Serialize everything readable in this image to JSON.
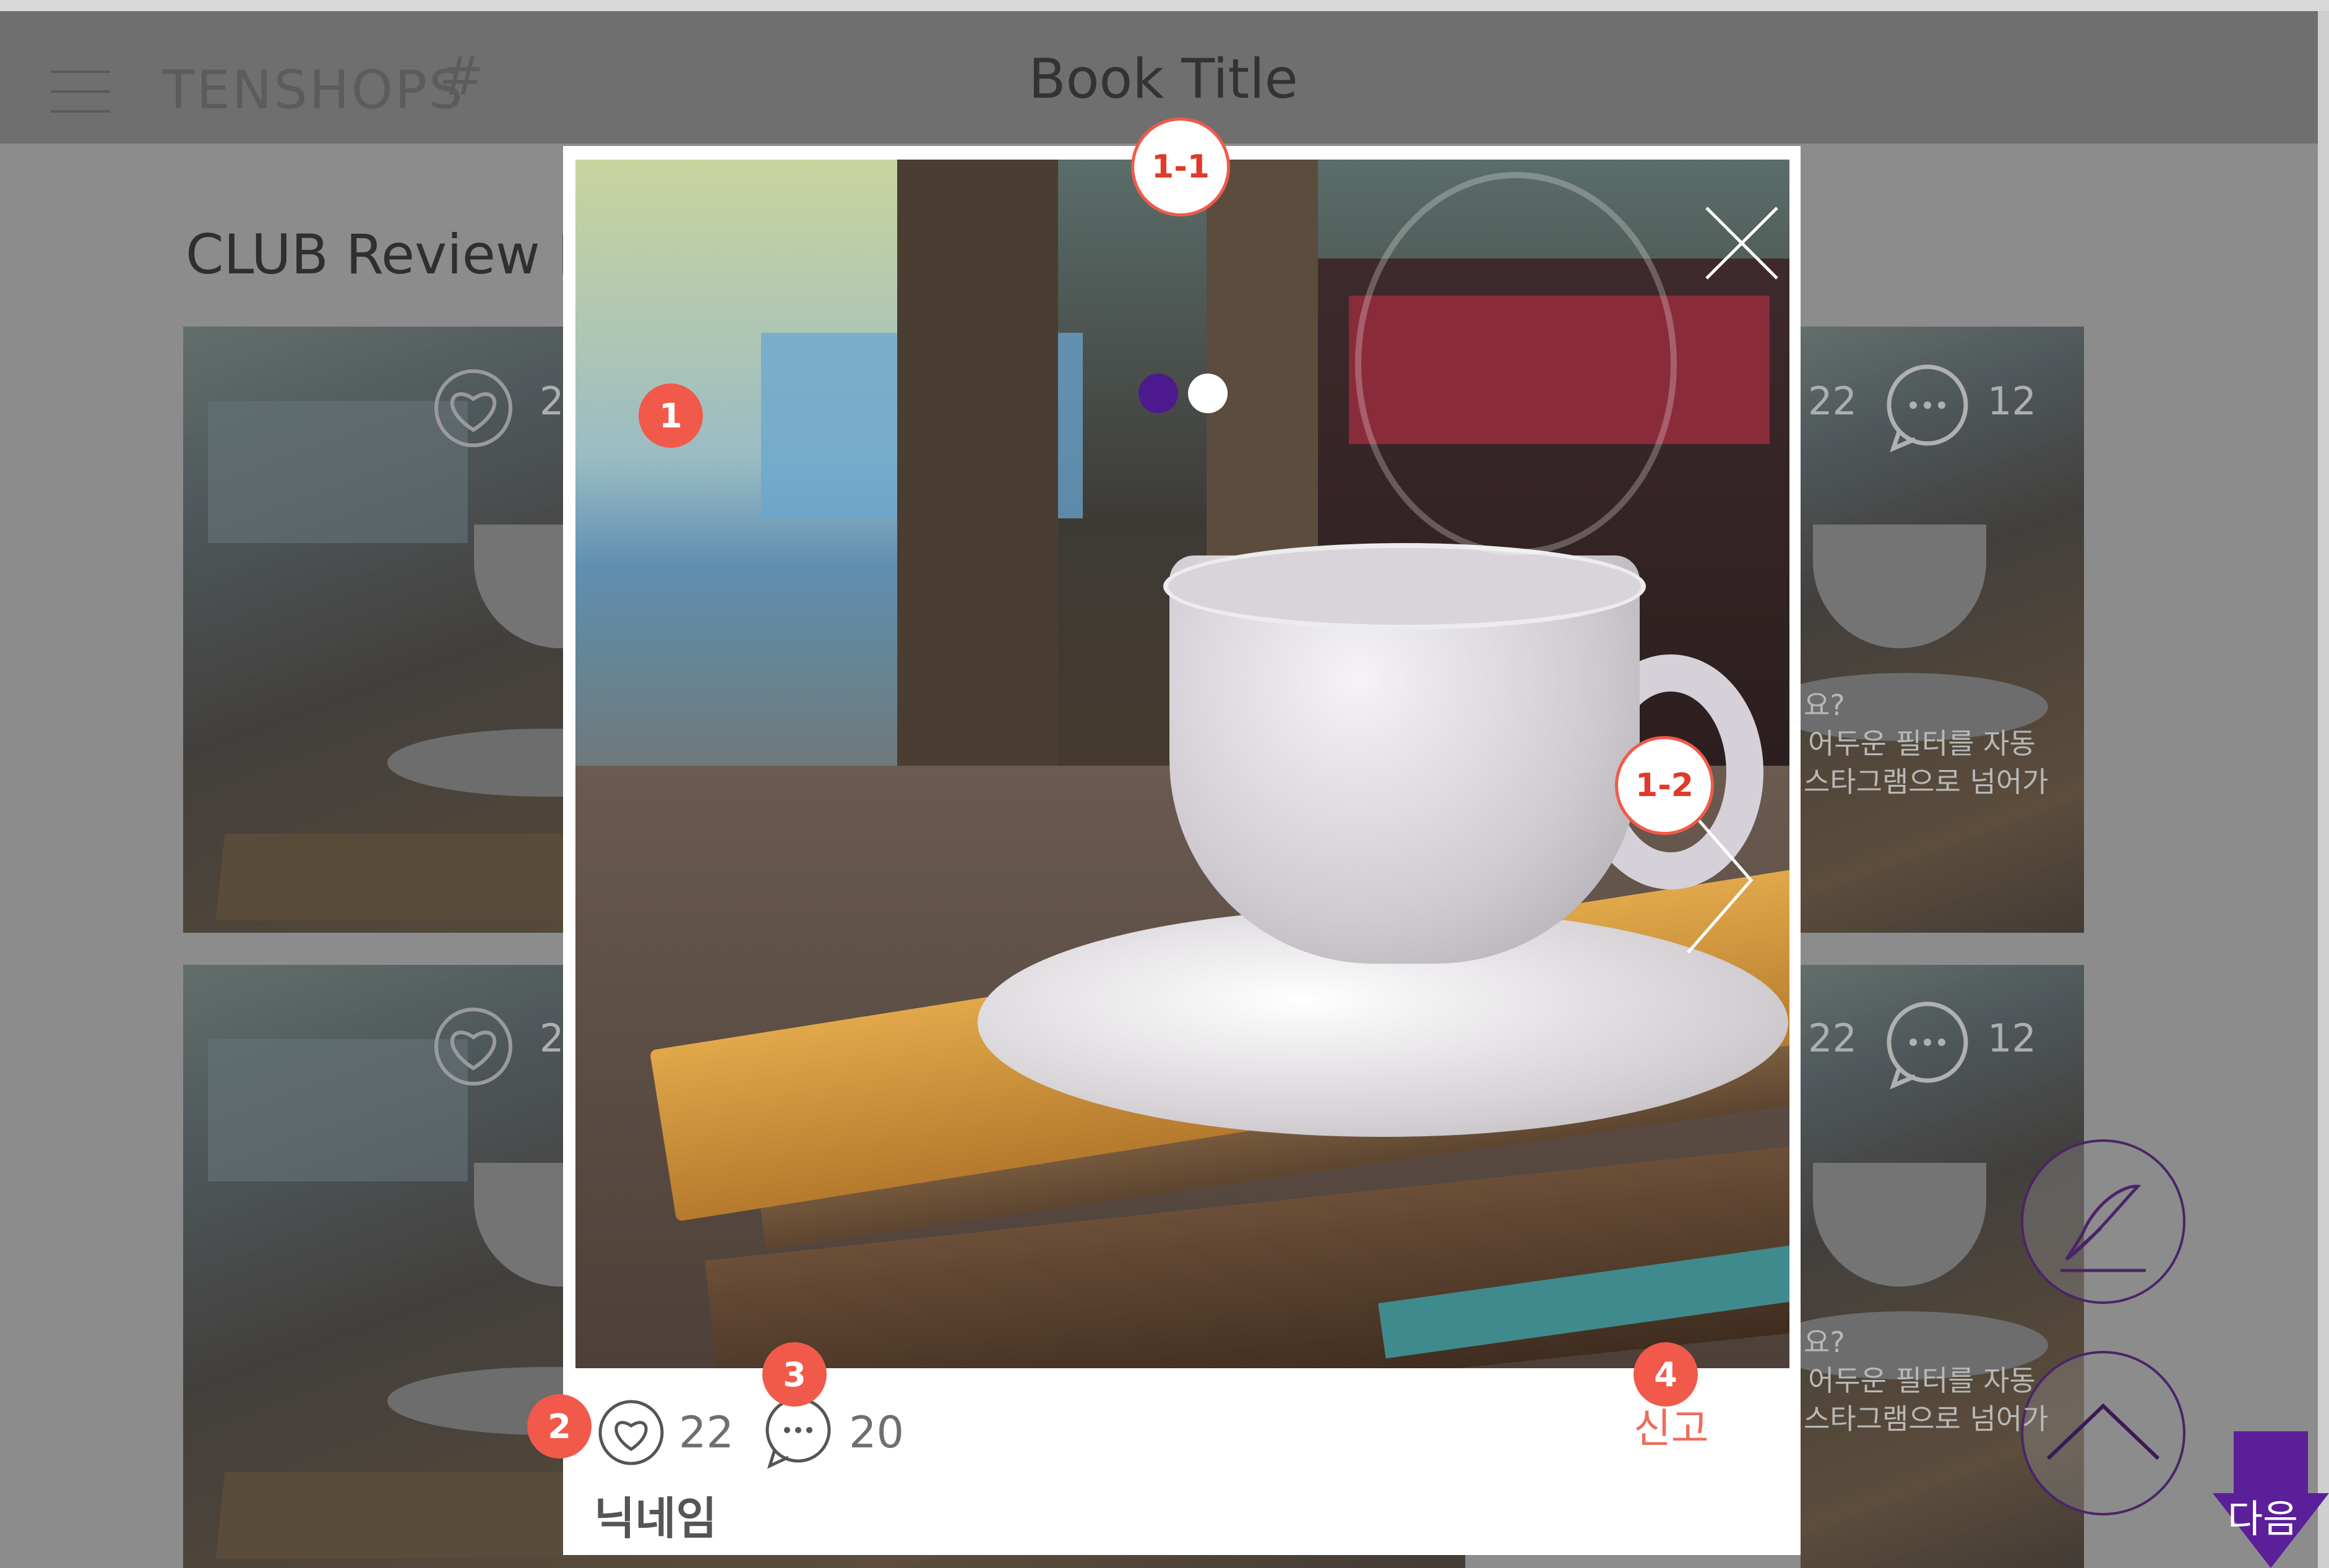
{
  "header": {
    "logo": "TENSHOPS",
    "logo_hash": "#",
    "title": "Book Title"
  },
  "section": {
    "title": "CLUB Review B"
  },
  "grid_cards": [
    {
      "likes": "2",
      "comments": ""
    },
    {
      "likes": "22",
      "comments": "12",
      "text_line1": "요?",
      "text_line2": "어두운 필터를 자동",
      "text_line3": "스타그램으로 넘어가"
    },
    {
      "likes": "2",
      "comments": ""
    },
    {
      "likes": "22",
      "comments": "12",
      "text_line1": "요?",
      "text_line2": "어두운 필터를 자동",
      "text_line3": "스타그램으로 넘어가"
    }
  ],
  "modal": {
    "likes": "22",
    "comments": "20",
    "report_label": "신고",
    "nickname": "닉네임",
    "slide_count": 2,
    "slide_active": 1
  },
  "annotations": {
    "m1": "1",
    "m1_1": "1-1",
    "m1_2": "1-2",
    "m2": "2",
    "m3": "3",
    "m4": "4"
  },
  "floating": {
    "next_label": "다음"
  },
  "colors": {
    "accent_purple": "#4c1a8e",
    "report_red": "#ef6c5a",
    "marker_red": "#f15a4a"
  }
}
